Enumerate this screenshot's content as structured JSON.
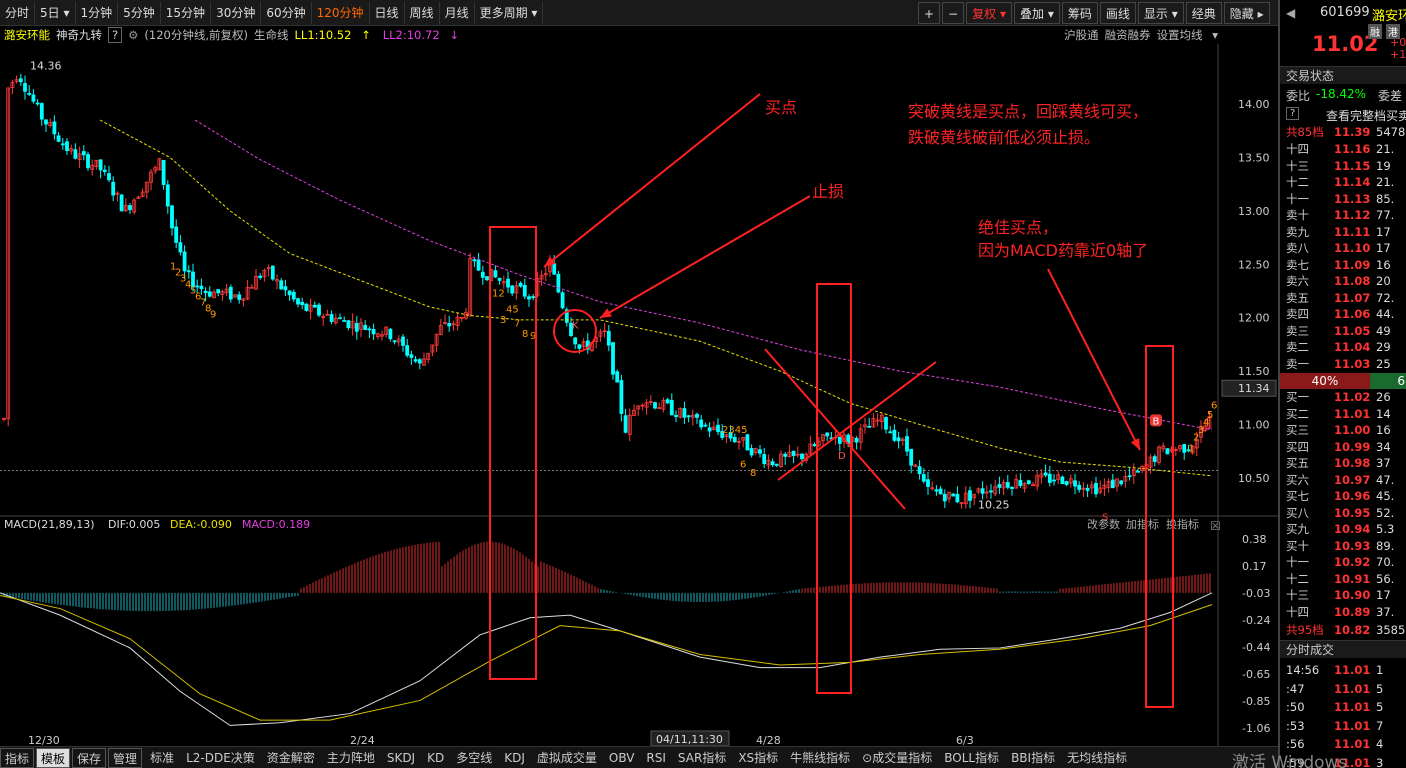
{
  "toolbar": {
    "periods": [
      "分时",
      "5日",
      "1分钟",
      "5分钟",
      "15分钟",
      "30分钟",
      "60分钟",
      "120分钟",
      "日线",
      "周线",
      "月线",
      "更多周期"
    ],
    "active": "120分钟",
    "right": [
      "复权",
      "叠加",
      "筹码",
      "画线",
      "显示",
      "经典",
      "隐藏"
    ],
    "plus": "+",
    "minus": "−"
  },
  "sub": {
    "name": "潞安环能",
    "indicator": "神奇九转",
    "help": "?",
    "info": "(120分钟线,前复权)",
    "life_label": "生命线",
    "ll1": "LL1:10.52",
    "ll2": "LL2:10.72",
    "links": [
      "沪股通",
      "融资融券",
      "设置均线"
    ]
  },
  "price_axis": [
    "14.00",
    "13.50",
    "13.00",
    "12.50",
    "12.00",
    "11.50",
    "11.00",
    "10.50"
  ],
  "macd_axis": [
    "0.38",
    "0.17",
    "-0.03",
    "-0.24",
    "-0.44",
    "-0.65",
    "-0.85",
    "-1.06"
  ],
  "current_price": "11.34",
  "price_labels": {
    "high": "14.36",
    "low": "10.25"
  },
  "macd_header": {
    "name": "MACD(21,89,13)",
    "dif": "DIF:0.005",
    "dea": "DEA:-0.090",
    "macd": "MACD:0.189",
    "change_params": "改参数",
    "add": "加指标",
    "switch": "换指标"
  },
  "date_axis": [
    "12/30",
    "2/24",
    "4/28",
    "6/3"
  ],
  "cursor_date": "04/11,11:30",
  "annotations": {
    "buy1": "买点",
    "stop": "止损",
    "note1": "突破黄线是买点，回踩黄线可买，",
    "note2": "跌破黄线破前低必须止损。",
    "best1": "绝佳买点，",
    "best2": "因为MACD药靠近0轴了",
    "b_mark": "B"
  },
  "td_marks": {
    "a": [
      "1",
      "2",
      "3",
      "4",
      "5",
      "6",
      "7",
      "8",
      "9"
    ],
    "b": [
      "12",
      "45",
      "3",
      "7",
      "8",
      "9",
      "K",
      "D",
      "2345",
      "6",
      "8",
      "S",
      "1",
      "2",
      "3",
      "4",
      "5",
      "6"
    ]
  },
  "right_panel": {
    "code": "601699",
    "name": "潞安环",
    "price": "11.02",
    "tag1": "融",
    "tag2": "港",
    "chg1": "+0",
    "chg2": "+1",
    "status": "交易状态",
    "webi_label": "委比",
    "webi": "-18.42%",
    "weicha": "委差",
    "help": "?",
    "view": "查看完整档买卖",
    "sell_total_label": "共85档",
    "sell_total_price": "11.39",
    "sell_total_vol": "5478",
    "sells": [
      [
        "十四",
        "11.16",
        "21."
      ],
      [
        "十三",
        "11.15",
        "19"
      ],
      [
        "十二",
        "11.14",
        "21."
      ],
      [
        "十一",
        "11.13",
        "85."
      ],
      [
        "卖十",
        "11.12",
        "77."
      ],
      [
        "卖九",
        "11.11",
        "17"
      ],
      [
        "卖八",
        "11.10",
        "17"
      ],
      [
        "卖七",
        "11.09",
        "16"
      ],
      [
        "卖六",
        "11.08",
        "20"
      ],
      [
        "卖五",
        "11.07",
        "72."
      ],
      [
        "卖四",
        "11.06",
        "44."
      ],
      [
        "卖三",
        "11.05",
        "49"
      ],
      [
        "卖二",
        "11.04",
        "29"
      ],
      [
        "卖一",
        "11.03",
        "25"
      ]
    ],
    "ratio": "40%",
    "ratio_r": "6",
    "buys": [
      [
        "买一",
        "11.02",
        "26"
      ],
      [
        "买二",
        "11.01",
        "14"
      ],
      [
        "买三",
        "11.00",
        "16"
      ],
      [
        "买四",
        "10.99",
        "34"
      ],
      [
        "买五",
        "10.98",
        "37"
      ],
      [
        "买六",
        "10.97",
        "47."
      ],
      [
        "买七",
        "10.96",
        "45."
      ],
      [
        "买八",
        "10.95",
        "52."
      ],
      [
        "买九",
        "10.94",
        "5.3"
      ],
      [
        "买十",
        "10.93",
        "89."
      ],
      [
        "十一",
        "10.92",
        "70."
      ],
      [
        "十二",
        "10.91",
        "56."
      ],
      [
        "十三",
        "10.90",
        "17"
      ],
      [
        "十四",
        "10.89",
        "37."
      ]
    ],
    "buy_total_label": "共95档",
    "buy_total_price": "10.82",
    "buy_total_vol": "3585",
    "ticks_title": "分时成交",
    "ticks": [
      [
        "14:56",
        "11.01",
        "1"
      ],
      [
        ":47",
        "11.01",
        "5"
      ],
      [
        ":50",
        "11.01",
        "5"
      ],
      [
        ":53",
        "11.01",
        "7"
      ],
      [
        ":56",
        "11.01",
        "4"
      ],
      [
        ":59",
        "11.01",
        "3"
      ]
    ]
  },
  "bottom": {
    "items": [
      "指标",
      "模板",
      "保存",
      "管理",
      "标准",
      "L2-DDE决策",
      "资金解密",
      "主力阵地",
      "SKDJ",
      "KD",
      "多空线",
      "KDJ",
      "虚拟成交量",
      "OBV",
      "RSI",
      "SAR指标",
      "XS指标",
      "牛熊线指标",
      "⊙成交量指标",
      "BOLL指标",
      "BBI指标",
      "无均线指标"
    ],
    "watermark": "激活 Windows"
  },
  "colors": {
    "up": "#ff3b3b",
    "down": "#00ffff",
    "yellow": "#e8e000",
    "magenta": "#e040e0",
    "red_box": "#ff2020",
    "macd_white": "#dddddd",
    "macd_yellow": "#d4c000"
  }
}
